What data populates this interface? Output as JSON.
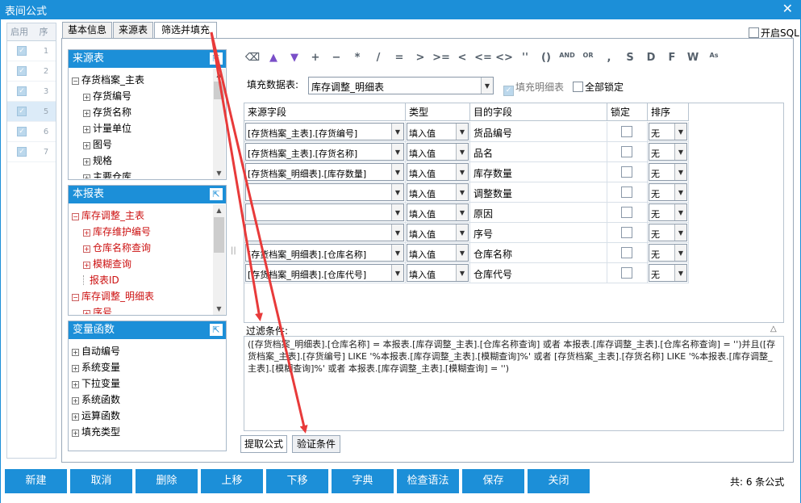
{
  "window": {
    "title": "表间公式"
  },
  "left_list": {
    "headers": [
      "启用",
      "序"
    ],
    "rows": [
      "1",
      "2",
      "3",
      "5",
      "6",
      "7"
    ]
  },
  "tabs": [
    "基本信息",
    "来源表",
    "筛选并填充"
  ],
  "open_sql": "开启SQL",
  "panes": {
    "source": {
      "title": "来源表",
      "items": [
        {
          "label": "存货档案_主表",
          "level": 0,
          "sign": "−"
        },
        {
          "label": "存货编号",
          "level": 1,
          "sign": "+"
        },
        {
          "label": "存货名称",
          "level": 1,
          "sign": "+"
        },
        {
          "label": "计量单位",
          "level": 1,
          "sign": "+"
        },
        {
          "label": "图号",
          "level": 1,
          "sign": "+"
        },
        {
          "label": "规格",
          "level": 1,
          "sign": "+"
        },
        {
          "label": "主要仓库",
          "level": 1,
          "sign": "+"
        }
      ]
    },
    "report": {
      "title": "本报表",
      "items": [
        {
          "label": "库存调整_主表",
          "level": 0,
          "sign": "−"
        },
        {
          "label": "库存维护编号",
          "level": 1,
          "sign": "+"
        },
        {
          "label": "仓库名称查询",
          "level": 1,
          "sign": "+"
        },
        {
          "label": "模糊查询",
          "level": 1,
          "sign": "+"
        },
        {
          "label": "报表ID",
          "level": 1,
          "sign": ""
        },
        {
          "label": "库存调整_明细表",
          "level": 0,
          "sign": "−"
        },
        {
          "label": "序号",
          "level": 1,
          "sign": "+"
        }
      ]
    },
    "vars": {
      "title": "变量函数",
      "items": [
        {
          "label": "自动编号",
          "level": 0,
          "sign": "+"
        },
        {
          "label": "系统变量",
          "level": 0,
          "sign": "+"
        },
        {
          "label": "下拉变量",
          "level": 0,
          "sign": "+"
        },
        {
          "label": "系统函数",
          "level": 0,
          "sign": "+"
        },
        {
          "label": "运算函数",
          "level": 0,
          "sign": "+"
        },
        {
          "label": "填充类型",
          "level": 0,
          "sign": "+"
        }
      ]
    }
  },
  "toolbar": [
    "+",
    "−",
    "*",
    "/",
    "=",
    ">",
    ">=",
    "<",
    "<=",
    "<>",
    "''",
    "()",
    "AND",
    "OR",
    ",",
    "S",
    "D",
    "F",
    "W",
    "As"
  ],
  "fill": {
    "label": "填充数据表:",
    "value": "库存调整_明细表",
    "fill_detail": "填充明细表",
    "lock_all": "全部锁定"
  },
  "grid": {
    "headers": [
      "来源字段",
      "类型",
      "目的字段",
      "锁定",
      "排序"
    ],
    "rows": [
      {
        "source": "[存货档案_主表].[存货编号]",
        "type": "填入值",
        "target": "货品编号",
        "sort": "无"
      },
      {
        "source": "[存货档案_主表].[存货名称]",
        "type": "填入值",
        "target": "品名",
        "sort": "无"
      },
      {
        "source": "[存货档案_明细表].[库存数量]",
        "type": "填入值",
        "target": "库存数量",
        "sort": "无"
      },
      {
        "source": "",
        "type": "填入值",
        "target": "调整数量",
        "sort": "无"
      },
      {
        "source": "",
        "type": "填入值",
        "target": "原因",
        "sort": "无"
      },
      {
        "source": "",
        "type": "填入值",
        "target": "序号",
        "sort": "无"
      },
      {
        "source": "[存货档案_明细表].[仓库名称]",
        "type": "填入值",
        "target": "仓库名称",
        "sort": "无"
      },
      {
        "source": "[存货档案_明细表].[仓库代号]",
        "type": "填入值",
        "target": "仓库代号",
        "sort": "无"
      }
    ]
  },
  "filter": {
    "label": "过滤条件:",
    "text": "([存货档案_明细表].[仓库名称] = 本报表.[库存调整_主表].[仓库名称查询] 或者 本报表.[库存调整_主表].[仓库名称查询] = '')并且([存货档案_主表].[存货编号] LIKE '%本报表.[库存调整_主表].[模糊查询]%' 或者 [存货档案_主表].[存货名称] LIKE '%本报表.[库存调整_主表].[模糊查询]%' 或者 本报表.[库存调整_主表].[模糊查询] = '')"
  },
  "bottom_tabs": [
    "提取公式",
    "验证条件"
  ],
  "buttons": [
    "新建",
    "取消",
    "删除",
    "上移",
    "下移",
    "字典",
    "检查语法",
    "保存",
    "关闭"
  ],
  "total": "共:  6 条公式",
  "colors": {
    "accent": "#1c8fd8",
    "arrow": "#e83a3a"
  }
}
